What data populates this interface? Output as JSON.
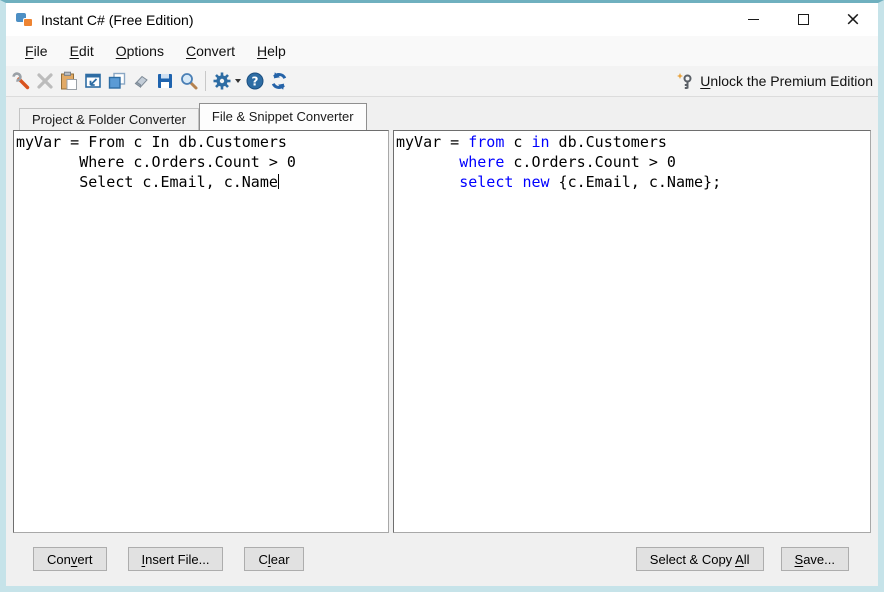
{
  "colors": {
    "frame": "#c6e3e9",
    "frame_top": "#6fb0bf",
    "keyword": "#0000ff",
    "icon_blue": "#4d8fc4",
    "icon_orange": "#ee8432",
    "toolbar_blue": "#2e6da4"
  },
  "window": {
    "title": "Instant C# (Free Edition)"
  },
  "menu": {
    "items": [
      {
        "pre": "",
        "key": "F",
        "post": "ile"
      },
      {
        "pre": "",
        "key": "E",
        "post": "dit"
      },
      {
        "pre": "",
        "key": "O",
        "post": "ptions"
      },
      {
        "pre": "",
        "key": "C",
        "post": "onvert"
      },
      {
        "pre": "",
        "key": "H",
        "post": "elp"
      }
    ]
  },
  "toolbar": {
    "icons": [
      "options-tools",
      "delete",
      "paste",
      "insert-file",
      "copy",
      "clear-eraser",
      "save",
      "find",
      "settings-gear",
      "help",
      "convert-refresh"
    ],
    "unlock": {
      "pre": "",
      "key": "U",
      "post": "nlock the Premium Edition"
    }
  },
  "tabs": [
    {
      "label": "Project & Folder Converter",
      "active": false
    },
    {
      "label": "File & Snippet Converter",
      "active": true
    }
  ],
  "editors": {
    "keyword_color": "#0000ff",
    "left_language": "VB",
    "right_language": "C#",
    "left": {
      "lines": [
        [
          {
            "t": "myVar = From c In db.Customers"
          }
        ],
        [
          {
            "t": "       Where c.Orders.Count > 0"
          }
        ],
        [
          {
            "t": "       Select c.Email, c.Name"
          },
          {
            "caret": true
          }
        ]
      ]
    },
    "right": {
      "lines": [
        [
          {
            "t": "myVar = "
          },
          {
            "t": "from",
            "kw": true
          },
          {
            "t": " c "
          },
          {
            "t": "in",
            "kw": true
          },
          {
            "t": " db.Customers"
          }
        ],
        [
          {
            "t": "       "
          },
          {
            "t": "where",
            "kw": true
          },
          {
            "t": " c.Orders.Count > 0"
          }
        ],
        [
          {
            "t": "       "
          },
          {
            "t": "select",
            "kw": true
          },
          {
            "t": " "
          },
          {
            "t": "new",
            "kw": true
          },
          {
            "t": " {c.Email, c.Name};"
          }
        ]
      ]
    }
  },
  "buttons": {
    "convert": {
      "pre": "Con",
      "key": "v",
      "post": "ert"
    },
    "insert_file": {
      "pre": "",
      "key": "I",
      "post": "nsert File..."
    },
    "clear": {
      "pre": "C",
      "key": "l",
      "post": "ear"
    },
    "select_copy_all": {
      "pre": "Select & Copy ",
      "key": "A",
      "post": "ll"
    },
    "save": {
      "pre": "",
      "key": "S",
      "post": "ave..."
    }
  }
}
